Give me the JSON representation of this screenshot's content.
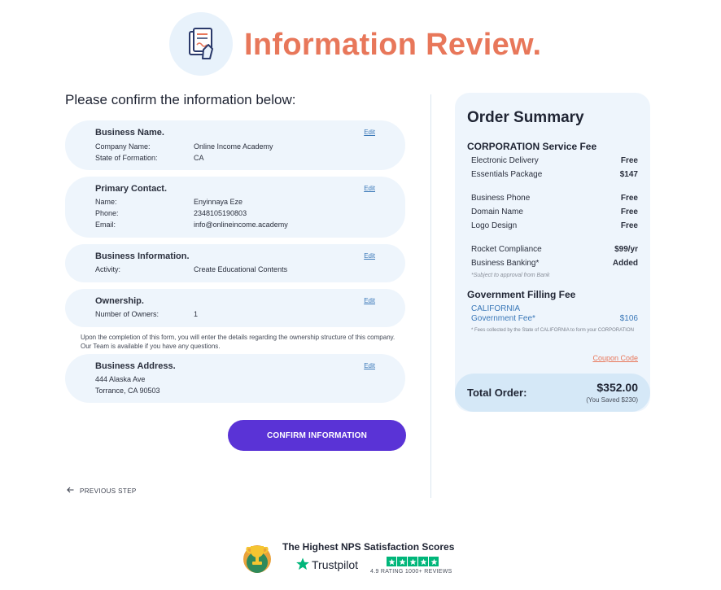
{
  "header": {
    "title": "Information Review."
  },
  "subtitle": "Please confirm the information below:",
  "edit_label": "Edit",
  "business_name": {
    "title": "Business Name.",
    "rows": [
      {
        "label": "Company Name:",
        "value": "Online Income Academy"
      },
      {
        "label": "State of Formation:",
        "value": "CA"
      }
    ]
  },
  "primary_contact": {
    "title": "Primary Contact.",
    "rows": [
      {
        "label": "Name:",
        "value": "Enyinnaya Eze"
      },
      {
        "label": "Phone:",
        "value": "2348105190803"
      },
      {
        "label": "Email:",
        "value": "info@onlineincome.academy"
      }
    ]
  },
  "business_information": {
    "title": "Business Information.",
    "rows": [
      {
        "label": "Activity:",
        "value": "Create Educational Contents"
      }
    ]
  },
  "ownership": {
    "title": "Ownership.",
    "rows": [
      {
        "label": "Number of Owners:",
        "value": "1"
      }
    ]
  },
  "ownership_notice": "Upon the completion of this form, you will enter the details regarding the ownership structure of this company. Our Team is available if you have any questions.",
  "business_address": {
    "title": "Business Address.",
    "lines": [
      "444 Alaska Ave",
      "Torrance, CA 90503"
    ]
  },
  "confirm_button": "CONFIRM INFORMATION",
  "previous_step": "PREVIOUS STEP",
  "order_summary": {
    "title": "Order Summary",
    "service_fee_title": "CORPORATION Service Fee",
    "items_group1": [
      {
        "label": "Electronic Delivery",
        "value": "Free"
      },
      {
        "label": "Essentials Package",
        "value": "$147"
      }
    ],
    "items_group2": [
      {
        "label": "Business Phone",
        "value": "Free"
      },
      {
        "label": "Domain Name",
        "value": "Free"
      },
      {
        "label": "Logo Design",
        "value": "Free"
      }
    ],
    "items_group3": [
      {
        "label": "Rocket Compliance",
        "value": "$99/yr"
      },
      {
        "label": "Business Banking*",
        "value": "Added"
      }
    ],
    "banking_note": "*Subject to approval from Bank",
    "gov_fee_title": "Government Filling Fee",
    "gov_state": "CALIFORNIA",
    "gov_fee_label": "Government Fee*",
    "gov_fee_value": "$106",
    "fee_note": "* Fees collected by the State of CALIFORNIA to form your CORPORATION",
    "coupon": "Coupon Code",
    "total_label": "Total Order:",
    "total_amount": "$352.00",
    "total_saved": "(You Saved $230)"
  },
  "footer": {
    "headline": "The Highest NPS Satisfaction Scores",
    "trustpilot": "Trustpilot",
    "rating_text": "4.9 RATING  1000+ REVIEWS",
    "stars": 5
  },
  "colors": {
    "accent_title": "#e8775a",
    "button": "#5a33d6",
    "card_bg": "#eef5fc",
    "link": "#3a78b8",
    "trustpilot_green": "#00b67a"
  }
}
